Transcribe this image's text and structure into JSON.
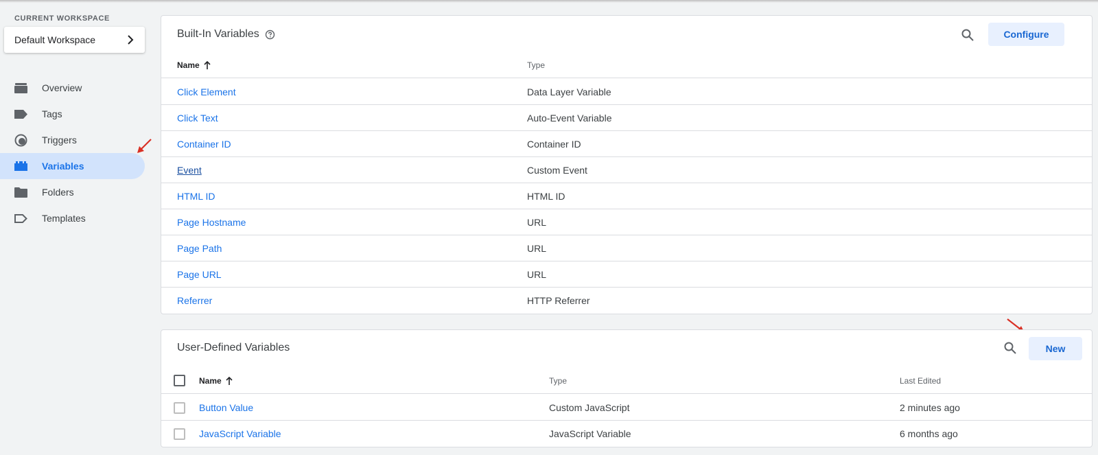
{
  "sidebar": {
    "workspace_label": "CURRENT WORKSPACE",
    "workspace_name": "Default Workspace",
    "items": [
      {
        "label": "Overview",
        "icon": "overview-icon"
      },
      {
        "label": "Tags",
        "icon": "tag-icon"
      },
      {
        "label": "Triggers",
        "icon": "trigger-icon"
      },
      {
        "label": "Variables",
        "icon": "variables-icon",
        "active": true
      },
      {
        "label": "Folders",
        "icon": "folder-icon"
      },
      {
        "label": "Templates",
        "icon": "template-icon"
      }
    ]
  },
  "builtin": {
    "title": "Built-In Variables",
    "configure_label": "Configure",
    "columns": {
      "name": "Name",
      "type": "Type"
    },
    "rows": [
      {
        "name": "Click Element",
        "type": "Data Layer Variable"
      },
      {
        "name": "Click Text",
        "type": "Auto-Event Variable"
      },
      {
        "name": "Container ID",
        "type": "Container ID"
      },
      {
        "name": "Event",
        "type": "Custom Event"
      },
      {
        "name": "HTML ID",
        "type": "HTML ID"
      },
      {
        "name": "Page Hostname",
        "type": "URL"
      },
      {
        "name": "Page Path",
        "type": "URL"
      },
      {
        "name": "Page URL",
        "type": "URL"
      },
      {
        "name": "Referrer",
        "type": "HTTP Referrer"
      }
    ]
  },
  "userdefined": {
    "title": "User-Defined Variables",
    "new_label": "New",
    "columns": {
      "name": "Name",
      "type": "Type",
      "last_edited": "Last Edited"
    },
    "rows": [
      {
        "name": "Button Value",
        "type": "Custom JavaScript",
        "last_edited": "2 minutes ago"
      },
      {
        "name": "JavaScript Variable",
        "type": "JavaScript Variable",
        "last_edited": "6 months ago"
      }
    ]
  },
  "colors": {
    "accent": "#1a73e8",
    "active_bg": "#d2e3fc",
    "button_bg": "#e8f0fe",
    "annotation": "#d93025"
  }
}
